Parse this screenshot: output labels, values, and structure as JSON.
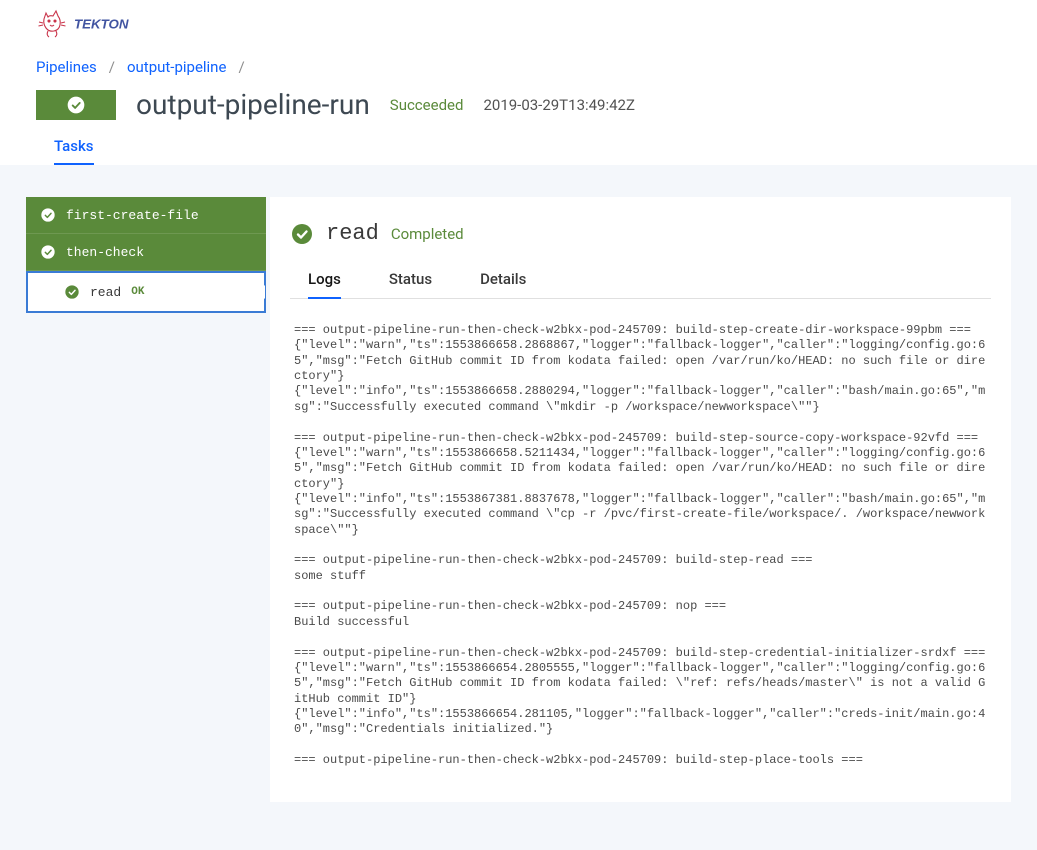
{
  "logo_text": "TEKTON",
  "breadcrumb": [
    {
      "label": "Pipelines"
    },
    {
      "label": "output-pipeline"
    }
  ],
  "run": {
    "name": "output-pipeline-run",
    "status": "Succeeded",
    "timestamp": "2019-03-29T13:49:42Z"
  },
  "top_tabs": [
    {
      "label": "Tasks",
      "active": true
    }
  ],
  "tasks": [
    {
      "name": "first-create-file"
    },
    {
      "name": "then-check"
    }
  ],
  "step": {
    "name": "read",
    "status": "OK"
  },
  "detail": {
    "title": "read",
    "status": "Completed"
  },
  "sub_tabs": [
    {
      "label": "Logs",
      "active": true
    },
    {
      "label": "Status",
      "active": false
    },
    {
      "label": "Details",
      "active": false
    }
  ],
  "logs": "=== output-pipeline-run-then-check-w2bkx-pod-245709: build-step-create-dir-workspace-99pbm ===\n{\"level\":\"warn\",\"ts\":1553866658.2868867,\"logger\":\"fallback-logger\",\"caller\":\"logging/config.go:65\",\"msg\":\"Fetch GitHub commit ID from kodata failed: open /var/run/ko/HEAD: no such file or directory\"}\n{\"level\":\"info\",\"ts\":1553866658.2880294,\"logger\":\"fallback-logger\",\"caller\":\"bash/main.go:65\",\"msg\":\"Successfully executed command \\\"mkdir -p /workspace/newworkspace\\\"\"}\n\n=== output-pipeline-run-then-check-w2bkx-pod-245709: build-step-source-copy-workspace-92vfd ===\n{\"level\":\"warn\",\"ts\":1553866658.5211434,\"logger\":\"fallback-logger\",\"caller\":\"logging/config.go:65\",\"msg\":\"Fetch GitHub commit ID from kodata failed: open /var/run/ko/HEAD: no such file or directory\"}\n{\"level\":\"info\",\"ts\":1553867381.8837678,\"logger\":\"fallback-logger\",\"caller\":\"bash/main.go:65\",\"msg\":\"Successfully executed command \\\"cp -r /pvc/first-create-file/workspace/. /workspace/newworkspace\\\"\"}\n\n=== output-pipeline-run-then-check-w2bkx-pod-245709: build-step-read ===\nsome stuff\n\n=== output-pipeline-run-then-check-w2bkx-pod-245709: nop ===\nBuild successful\n\n=== output-pipeline-run-then-check-w2bkx-pod-245709: build-step-credential-initializer-srdxf ===\n{\"level\":\"warn\",\"ts\":1553866654.2805555,\"logger\":\"fallback-logger\",\"caller\":\"logging/config.go:65\",\"msg\":\"Fetch GitHub commit ID from kodata failed: \\\"ref: refs/heads/master\\\" is not a valid GitHub commit ID\"}\n{\"level\":\"info\",\"ts\":1553866654.281105,\"logger\":\"fallback-logger\",\"caller\":\"creds-init/main.go:40\",\"msg\":\"Credentials initialized.\"}\n\n=== output-pipeline-run-then-check-w2bkx-pod-245709: build-step-place-tools ==="
}
